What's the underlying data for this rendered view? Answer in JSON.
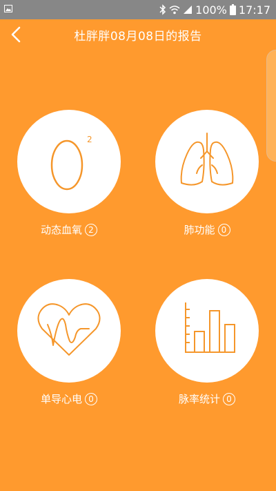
{
  "status_bar": {
    "battery_percent": "100%",
    "time": "17:17",
    "icons": [
      "image-icon",
      "bluetooth-icon",
      "wifi-icon",
      "signal-icon",
      "battery-icon"
    ]
  },
  "header": {
    "back_icon": "chevron-left-icon",
    "title": "杜胖胖08月08日的报告"
  },
  "tiles": [
    {
      "label": "动态血氧",
      "count": "2",
      "icon": "o2-icon"
    },
    {
      "label": "肺功能",
      "count": "0",
      "icon": "lungs-icon"
    },
    {
      "label": "单导心电",
      "count": "0",
      "icon": "heart-ecg-icon"
    },
    {
      "label": "脉率统计",
      "count": "0",
      "icon": "bar-chart-icon"
    }
  ],
  "colors": {
    "background": "#FF9A2E",
    "accent": "#F5962A",
    "status_bar": "#878787"
  }
}
